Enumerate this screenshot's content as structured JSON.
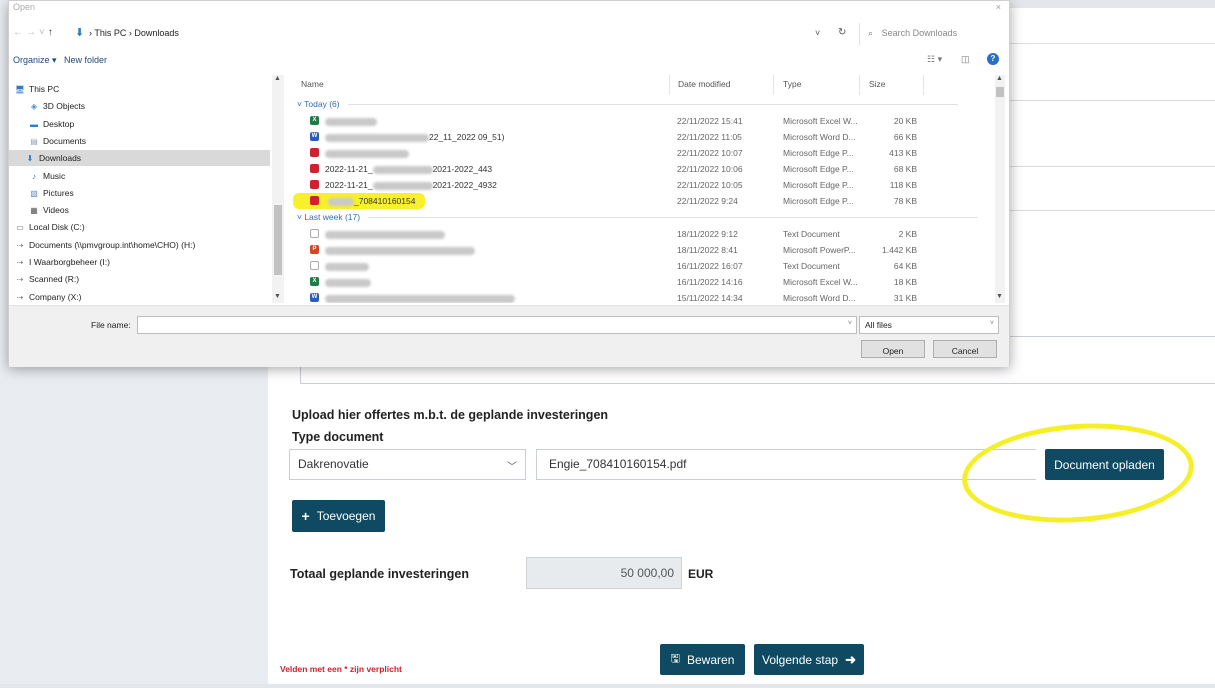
{
  "dialog": {
    "title": "Open",
    "close": "×",
    "breadcrumb": "› This PC › Downloads",
    "search_placeholder": "Search Downloads",
    "toolbar": {
      "organize": "Organize ▾",
      "new_folder": "New folder"
    },
    "nav_items": [
      {
        "label": "This PC",
        "icon": "computer-icon"
      },
      {
        "label": "3D Objects",
        "icon": "cube-icon"
      },
      {
        "label": "Desktop",
        "icon": "desktop-icon"
      },
      {
        "label": "Documents",
        "icon": "document-icon"
      },
      {
        "label": "Downloads",
        "icon": "download-icon",
        "selected": true
      },
      {
        "label": "Music",
        "icon": "music-icon"
      },
      {
        "label": "Pictures",
        "icon": "picture-icon"
      },
      {
        "label": "Videos",
        "icon": "video-icon"
      },
      {
        "label": "Local Disk (C:)",
        "icon": "drive-icon"
      },
      {
        "label": "Documents (\\\\pmvgroup.int\\home\\CHO) (H:)",
        "icon": "network-drive-icon"
      },
      {
        "label": "I Waarborgbeheer (I:)",
        "icon": "network-drive-icon"
      },
      {
        "label": "Scanned (R:)",
        "icon": "network-drive-icon"
      },
      {
        "label": "Company (X:)",
        "icon": "network-drive-icon"
      }
    ],
    "columns": {
      "name": "Name",
      "date": "Date modified",
      "type": "Type",
      "size": "Size"
    },
    "groups": [
      {
        "label": "Today (6)"
      },
      {
        "label": "Last week (17)"
      }
    ],
    "files_today": [
      {
        "kind": "excel",
        "name": "",
        "date": "22/11/2022 15:41",
        "type": "Microsoft Excel W...",
        "size": "20 KB"
      },
      {
        "kind": "word",
        "name": "22_11_2022 09_51)",
        "date": "22/11/2022 11:05",
        "type": "Microsoft Word D...",
        "size": "66 KB"
      },
      {
        "kind": "pdf",
        "name": "",
        "date": "22/11/2022 10:07",
        "type": "Microsoft Edge P...",
        "size": "413 KB"
      },
      {
        "kind": "pdf",
        "name": "2022-11-21_",
        "name_tail": "2021-2022_443",
        "date": "22/11/2022 10:06",
        "type": "Microsoft Edge P...",
        "size": "68 KB"
      },
      {
        "kind": "pdf",
        "name": "2022-11-21_",
        "name_tail": "2021-2022_4932",
        "date": "22/11/2022 10:05",
        "type": "Microsoft Edge P...",
        "size": "118 KB"
      },
      {
        "kind": "pdf",
        "name": "_708410160154",
        "date": "22/11/2022 9:24",
        "type": "Microsoft Edge P...",
        "size": "78 KB",
        "highlighted": true
      }
    ],
    "files_lastweek": [
      {
        "kind": "txt",
        "name": "",
        "date": "18/11/2022 9:12",
        "type": "Text Document",
        "size": "2 KB"
      },
      {
        "kind": "ppt",
        "name": "",
        "date": "18/11/2022 8:41",
        "type": "Microsoft PowerP...",
        "size": "1.442 KB"
      },
      {
        "kind": "txt",
        "name": "",
        "date": "16/11/2022 16:07",
        "type": "Text Document",
        "size": "64 KB"
      },
      {
        "kind": "excel",
        "name": "",
        "date": "16/11/2022 14:16",
        "type": "Microsoft Excel W...",
        "size": "18 KB"
      },
      {
        "kind": "word",
        "name": "",
        "date": "15/11/2022 14:34",
        "type": "Microsoft Word D...",
        "size": "31 KB"
      }
    ],
    "file_name_label": "File name:",
    "file_name_value": "",
    "filter": "All files",
    "open_button": "Open",
    "cancel_button": "Cancel"
  },
  "form": {
    "upload_heading": "Upload hier offertes m.b.t. de geplande investeringen",
    "type_label": "Type document",
    "type_selected": "Dakrenovatie",
    "file_value": "Engie_708410160154.pdf",
    "upload_button": "Document opladen",
    "add_button": "Toevoegen",
    "total_label": "Totaal geplande investeringen",
    "total_value": "50 000,00",
    "total_unit": "EUR",
    "required_note": "Velden met een * zijn verplicht",
    "save_button": "Bewaren",
    "next_button": "Volgende stap"
  },
  "colors": {
    "primary": "#0f4a62",
    "highlight": "#f5ef28",
    "required": "#d0202c"
  }
}
